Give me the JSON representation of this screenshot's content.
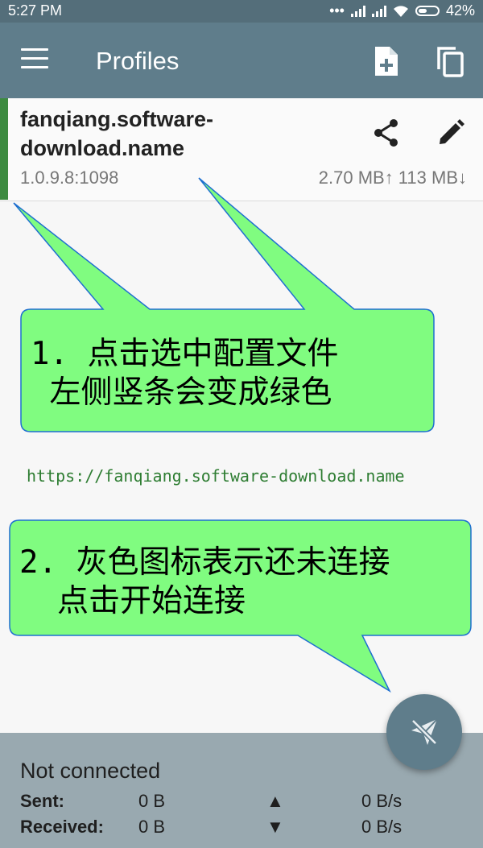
{
  "status_bar": {
    "time": "5:27 PM",
    "battery": "42%"
  },
  "app_bar": {
    "title": "Profiles",
    "icons": [
      "menu-icon",
      "add-file-icon",
      "copy-icon"
    ]
  },
  "profile": {
    "name": "fanqiang.software-download.name",
    "address": "1.0.9.8:1098",
    "traffic": "2.70 MB↑ 113 MB↓",
    "selected_color": "#3d8b40"
  },
  "callouts": [
    {
      "line1": "1. 点击选中配置文件",
      "line2": " 左侧竖条会变成绿色"
    },
    {
      "line1": "2. 灰色图标表示还未连接",
      "line2": "  点击开始连接"
    }
  ],
  "url_text": "https://fanqiang.software-download.name",
  "connection": {
    "state": "Not connected",
    "sent_label": "Sent:",
    "sent_value": "0 B",
    "sent_arrow": "▲",
    "sent_rate": "0 B/s",
    "received_label": "Received:",
    "received_value": "0 B",
    "received_arrow": "▼",
    "received_rate": "0 B/s"
  },
  "colors": {
    "appbar": "#5f7d8b",
    "callout_fill": "#80fc80",
    "bottom_panel": "#99a9b0"
  }
}
